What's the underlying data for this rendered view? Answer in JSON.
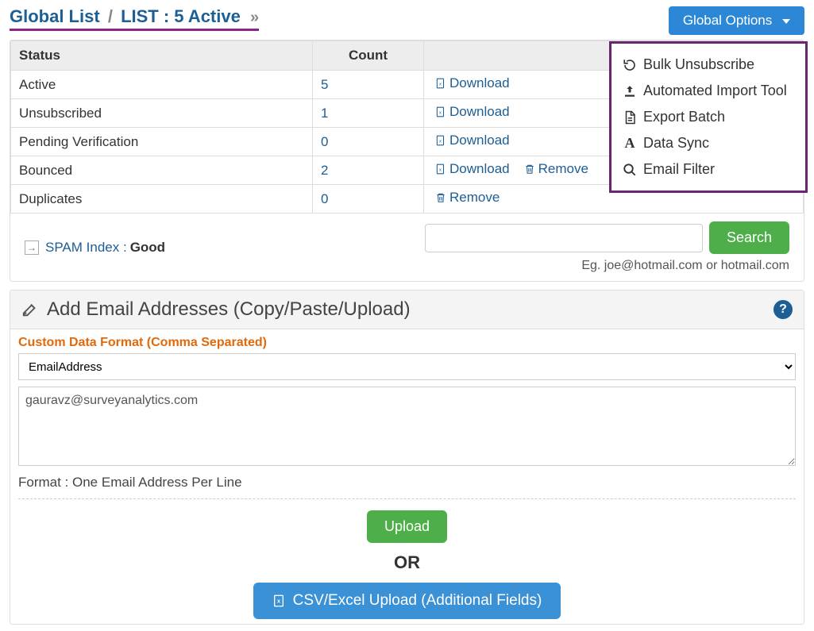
{
  "breadcrumb": {
    "part1": "Global List",
    "sep": "/",
    "part2": "LIST :  5 Active",
    "chevron": "»"
  },
  "global_options": {
    "button_label": "Global Options",
    "items": [
      {
        "label": "Bulk Unsubscribe"
      },
      {
        "label": "Automated Import Tool"
      },
      {
        "label": "Export Batch"
      },
      {
        "label": "Data Sync"
      },
      {
        "label": "Email Filter"
      }
    ]
  },
  "table": {
    "headers": {
      "status": "Status",
      "count": "Count"
    },
    "rows": [
      {
        "status": "Active",
        "count": "5",
        "download": "Download",
        "remove": null
      },
      {
        "status": "Unsubscribed",
        "count": "1",
        "download": "Download",
        "remove": null
      },
      {
        "status": "Pending Verification",
        "count": "0",
        "download": "Download",
        "remove": null
      },
      {
        "status": "Bounced",
        "count": "2",
        "download": "Download",
        "remove": "Remove"
      },
      {
        "status": "Duplicates",
        "count": "0",
        "download": null,
        "remove": "Remove"
      }
    ]
  },
  "spam_index": {
    "label": "SPAM Index :",
    "value": "Good"
  },
  "search": {
    "button": "Search",
    "hint": "Eg. joe@hotmail.com or hotmail.com"
  },
  "add_panel": {
    "title": "Add Email Addresses (Copy/Paste/Upload)",
    "custom_format_label": "Custom Data Format (Comma Separated)",
    "format_selected": "EmailAddress",
    "textarea_value": "gauravz@surveyanalytics.com",
    "format_hint": "Format : One Email Address Per Line",
    "upload_button": "Upload",
    "or_text": "OR",
    "csv_button": "CSV/Excel Upload (Additional Fields)",
    "help": "?"
  }
}
